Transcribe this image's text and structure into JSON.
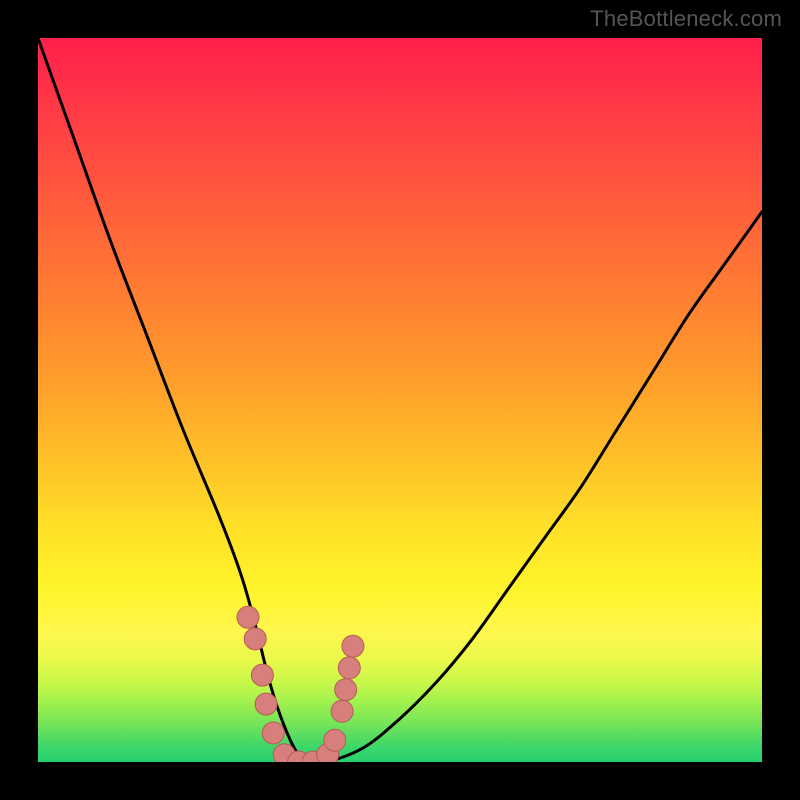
{
  "attribution": "TheBottleneck.com",
  "domain_note": "Bottleneck-style curve plot on a heat gradient.",
  "colors": {
    "background_frame": "#000000",
    "gradient_top": "#ff1f4b",
    "gradient_mid": "#ffe128",
    "gradient_bottom": "#27d070",
    "curve_stroke": "#000000",
    "marker_fill": "#d77f7c",
    "marker_stroke": "#b85a55"
  },
  "chart_data": {
    "type": "line",
    "x": [
      0,
      5,
      10,
      15,
      20,
      25,
      28,
      30,
      32,
      34,
      36,
      38,
      40,
      45,
      50,
      55,
      60,
      65,
      70,
      75,
      80,
      85,
      90,
      95,
      100
    ],
    "series": [
      {
        "name": "bottleneck-curve",
        "values": [
          100,
          86,
          72,
          59,
          46,
          34,
          26,
          19,
          11,
          5,
          1,
          0,
          0,
          2,
          6,
          11,
          17,
          24,
          31,
          38,
          46,
          54,
          62,
          69,
          76
        ]
      }
    ],
    "xlabel": "",
    "ylabel": "",
    "title": "",
    "xlim": [
      0,
      100
    ],
    "ylim": [
      0,
      100
    ],
    "markers": [
      {
        "x": 29,
        "y": 20
      },
      {
        "x": 30,
        "y": 17
      },
      {
        "x": 31,
        "y": 12
      },
      {
        "x": 31.5,
        "y": 8
      },
      {
        "x": 32.5,
        "y": 4
      },
      {
        "x": 34,
        "y": 1
      },
      {
        "x": 36,
        "y": 0
      },
      {
        "x": 38,
        "y": 0
      },
      {
        "x": 40,
        "y": 1
      },
      {
        "x": 41,
        "y": 3
      },
      {
        "x": 42,
        "y": 7
      },
      {
        "x": 42.5,
        "y": 10
      },
      {
        "x": 43,
        "y": 13
      },
      {
        "x": 43.5,
        "y": 16
      }
    ],
    "legend": false,
    "grid": false
  }
}
